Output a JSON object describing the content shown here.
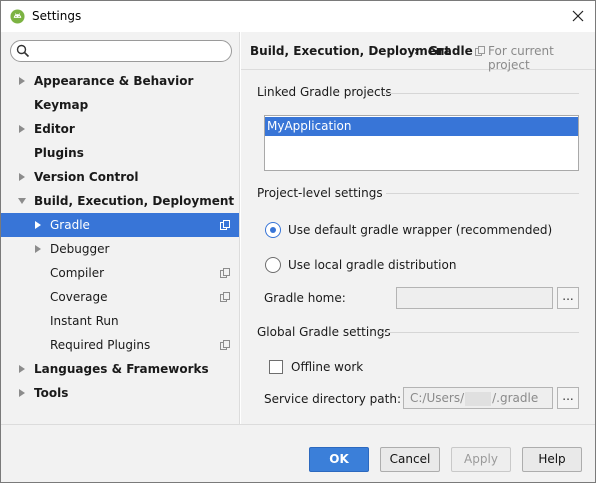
{
  "window": {
    "title": "Settings",
    "icon": "android-studio-icon"
  },
  "search": {
    "value": "",
    "placeholder": ""
  },
  "tree": [
    {
      "label": "Appearance & Behavior",
      "arrow": "collapsed",
      "bold": true,
      "indent": 0
    },
    {
      "label": "Keymap",
      "arrow": "none",
      "bold": true,
      "indent": 0
    },
    {
      "label": "Editor",
      "arrow": "collapsed",
      "bold": true,
      "indent": 0
    },
    {
      "label": "Plugins",
      "arrow": "none",
      "bold": true,
      "indent": 0
    },
    {
      "label": "Version Control",
      "arrow": "collapsed",
      "bold": true,
      "indent": 0
    },
    {
      "label": "Build, Execution, Deployment",
      "arrow": "expanded",
      "bold": true,
      "indent": 0
    },
    {
      "label": "Gradle",
      "arrow": "collapsed",
      "bold": false,
      "indent": 1,
      "selected": true,
      "project": true
    },
    {
      "label": "Debugger",
      "arrow": "collapsed",
      "bold": false,
      "indent": 1
    },
    {
      "label": "Compiler",
      "arrow": "none",
      "bold": false,
      "indent": 1,
      "project": true
    },
    {
      "label": "Coverage",
      "arrow": "none",
      "bold": false,
      "indent": 1,
      "project": true
    },
    {
      "label": "Instant Run",
      "arrow": "none",
      "bold": false,
      "indent": 1
    },
    {
      "label": "Required Plugins",
      "arrow": "none",
      "bold": false,
      "indent": 1,
      "project": true
    },
    {
      "label": "Languages & Frameworks",
      "arrow": "collapsed",
      "bold": true,
      "indent": 0
    },
    {
      "label": "Tools",
      "arrow": "collapsed",
      "bold": true,
      "indent": 0
    }
  ],
  "breadcrumb": {
    "parent": "Build, Execution, Deployment",
    "separator": "›",
    "current": "Gradle",
    "scope": "For current project"
  },
  "linked": {
    "title": "Linked Gradle projects",
    "projects": [
      "MyApplication"
    ]
  },
  "project_level": {
    "title": "Project-level settings",
    "option_wrapper": "Use default gradle wrapper (recommended)",
    "option_local": "Use local gradle distribution",
    "selected": "wrapper",
    "gradle_home_label": "Gradle home:",
    "gradle_home_value": ""
  },
  "global": {
    "title": "Global Gradle settings",
    "offline_label": "Offline work",
    "offline_checked": false,
    "service_dir_label": "Service directory path:",
    "service_dir_prefix": "C:/Users/",
    "service_dir_suffix": "/.gradle"
  },
  "browse_label": "...",
  "buttons": {
    "ok": "OK",
    "cancel": "Cancel",
    "apply": "Apply",
    "help": "Help"
  },
  "colors": {
    "accent": "#3875d7",
    "panel": "#f2f2f2",
    "android_green": "#8bc34a"
  }
}
